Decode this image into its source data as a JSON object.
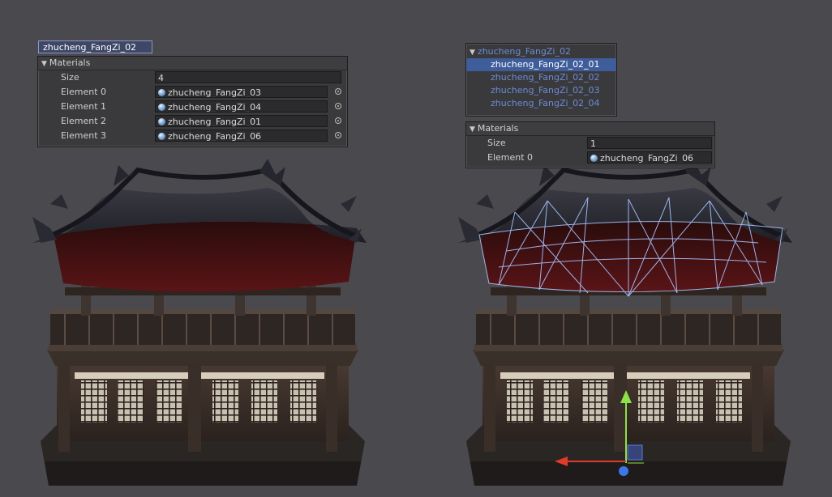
{
  "colors": {
    "viewport_bg": "#4a4a4e",
    "panel_bg": "#3a3a3c",
    "selection_blue": "#3f5d9a",
    "hierarchy_text": "#6b8bd6",
    "wireframe": "#a8c4ff",
    "gizmo_y": "#8ee04a",
    "gizmo_x": "#e03a2a",
    "gizmo_z": "#3a78e8"
  },
  "left_panel": {
    "object_name": "zhucheng_FangZi_02",
    "materials_header": "Materials",
    "size_label": "Size",
    "size_value": "4",
    "elements": [
      {
        "label": "Element 0",
        "value": "zhucheng_FangZi_03"
      },
      {
        "label": "Element 1",
        "value": "zhucheng_FangZi_04"
      },
      {
        "label": "Element 2",
        "value": "zhucheng_FangZi_01"
      },
      {
        "label": "Element 3",
        "value": "zhucheng_FangZi_06"
      }
    ]
  },
  "right_hierarchy": {
    "parent": "zhucheng_FangZi_02",
    "children": [
      "zhucheng_FangZi_02_01",
      "zhucheng_FangZi_02_02",
      "zhucheng_FangZi_02_03",
      "zhucheng_FangZi_02_04"
    ],
    "selected_index": 0
  },
  "right_panel": {
    "materials_header": "Materials",
    "size_label": "Size",
    "size_value": "1",
    "elements": [
      {
        "label": "Element 0",
        "value": "zhucheng_FangZi_06"
      }
    ]
  },
  "icons": {
    "collapse": "triangle-down-icon",
    "material": "material-sphere-icon",
    "object_picker": "object-picker-icon",
    "move_gizmo": "move-gizmo-icon"
  }
}
